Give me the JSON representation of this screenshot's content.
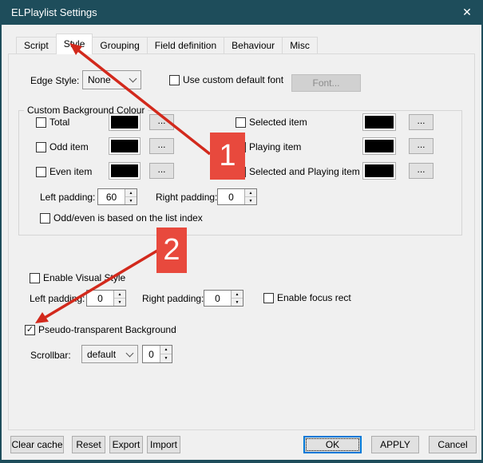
{
  "window": {
    "title": "ELPlaylist Settings"
  },
  "icons": {
    "close": "✕",
    "spin_up": "▲",
    "spin_down": "▼",
    "check": "✓",
    "ellipsis": "..."
  },
  "tabs": [
    {
      "label": "Script"
    },
    {
      "label": "Style"
    },
    {
      "label": "Grouping"
    },
    {
      "label": "Field definition"
    },
    {
      "label": "Behaviour"
    },
    {
      "label": "Misc"
    }
  ],
  "style_tab": {
    "edge_style_label": "Edge Style:",
    "edge_style_value": "None",
    "use_custom_font_label": "Use custom default font",
    "font_button": "Font...",
    "group_title": "Custom Background Colour",
    "rows_left": [
      "Total",
      "Odd item",
      "Even item"
    ],
    "rows_right": [
      "Selected item",
      "Playing item",
      "Selected and Playing item"
    ],
    "swatch_color": "#000000",
    "left_padding_label": "Left padding:",
    "left_padding_value": "60",
    "right_padding_label": "Right padding:",
    "right_padding_value": "0",
    "odd_even_label": "Odd/even is based on the list index",
    "enable_visual_style_label": "Enable Visual Style",
    "vs_left_padding_label": "Left padding:",
    "vs_left_padding_value": "0",
    "vs_right_padding_label": "Right padding:",
    "vs_right_padding_value": "0",
    "enable_focus_rect_label": "Enable focus rect",
    "pseudo_transparent_label": "Pseudo-transparent Background",
    "scrollbar_label": "Scrollbar:",
    "scrollbar_value": "default",
    "scrollbar_number": "0"
  },
  "footer": {
    "clear_cache": "Clear cache",
    "reset": "Reset",
    "export": "Export",
    "import": "Import",
    "ok": "OK",
    "apply": "APPLY",
    "cancel": "Cancel"
  },
  "annotations": {
    "badge1": "1",
    "badge2": "2",
    "box_color": "#e8493d",
    "arrow_color": "#d2291c"
  }
}
